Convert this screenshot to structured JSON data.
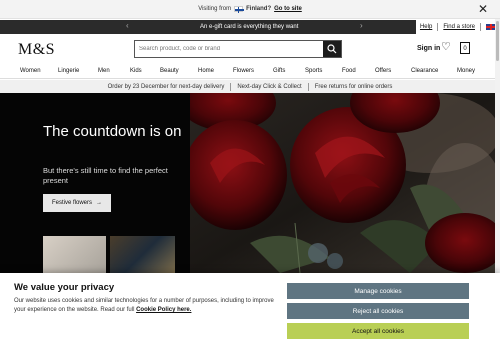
{
  "geo_banner": {
    "visiting_text": "Visiting from",
    "country": "Finland?",
    "link_text": "Go to site"
  },
  "promo": {
    "text": "An e-gift card is everything they want",
    "help": "Help",
    "find_store": "Find a store"
  },
  "header": {
    "logo": "M&S",
    "search_placeholder": "Search product, code or brand",
    "sign_in": "Sign in",
    "bag_count": "0"
  },
  "nav": {
    "items": [
      {
        "label": "Women"
      },
      {
        "label": "Lingerie"
      },
      {
        "label": "Men"
      },
      {
        "label": "Kids"
      },
      {
        "label": "Beauty"
      },
      {
        "label": "Home"
      },
      {
        "label": "Flowers"
      },
      {
        "label": "Gifts"
      },
      {
        "label": "Sports"
      },
      {
        "label": "Food"
      },
      {
        "label": "Offers"
      },
      {
        "label": "Clearance"
      },
      {
        "label": "Money"
      }
    ]
  },
  "delivery": {
    "items": [
      {
        "label": "Order by 23 December for next-day delivery"
      },
      {
        "label": "Next-day Click & Collect"
      },
      {
        "label": "Free returns for online orders"
      }
    ]
  },
  "hero": {
    "title": "The countdown is on",
    "subtitle": "But there's still time to find the perfect present",
    "button_label": "Festive flowers"
  },
  "cookie": {
    "title": "We value your privacy",
    "text": "Our website uses cookies and similar technologies for a number of purposes, including to improve your experience on the website. Read our full",
    "link": "Cookie Policy here.",
    "manage": "Manage cookies",
    "reject": "Reject all cookies",
    "accept": "Accept all cookies"
  },
  "colors": {
    "cookie_button": "#5f7582",
    "accept_button": "#b9cf55",
    "promo_bar": "#2b2b2b",
    "hero_bg": "#050505"
  }
}
